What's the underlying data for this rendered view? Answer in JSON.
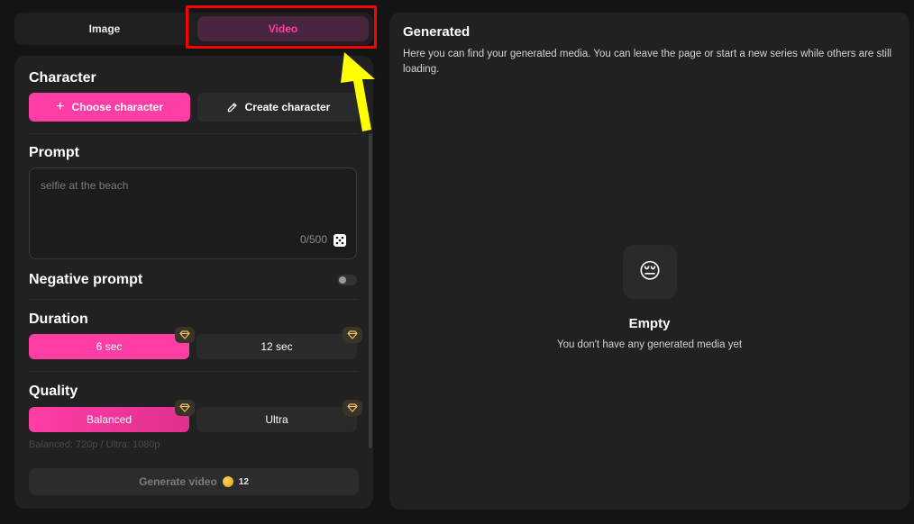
{
  "tabs": {
    "image_label": "Image",
    "video_label": "Video",
    "selected": "Video"
  },
  "character": {
    "title": "Character",
    "choose_label": "Choose character",
    "create_label": "Create character"
  },
  "prompt": {
    "title": "Prompt",
    "placeholder": "selfie at the beach",
    "count": "0/500"
  },
  "negative_prompt": {
    "title": "Negative prompt",
    "enabled": false
  },
  "duration": {
    "title": "Duration",
    "options": [
      "6 sec",
      "12 sec"
    ],
    "selected": "6 sec"
  },
  "quality": {
    "title": "Quality",
    "options": [
      "Balanced",
      "Ultra"
    ],
    "selected": "Balanced",
    "note": "Balanced: 720p / Ultra: 1080p"
  },
  "generate": {
    "label": "Generate video",
    "cost": "12"
  },
  "results": {
    "title": "Generated",
    "description": "Here you can find your generated media. You can leave the page or start a new series while others are still loading.",
    "empty_emoji": "😔",
    "empty_title": "Empty",
    "empty_text": "You don't have any generated media yet"
  },
  "colors": {
    "accent": "#ff3ea5",
    "background": "#141414",
    "panel": "#212121",
    "annotation_box": "#ff0000",
    "annotation_arrow": "#ffff00"
  }
}
